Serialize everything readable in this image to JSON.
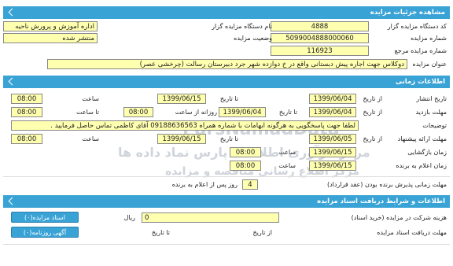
{
  "sections": {
    "details_title": "مشاهده جزئیات مزایده",
    "times_title": "اطلاعات زمانی",
    "conditions_title": "اطلاعات و شرایط دریافت اسناد مزایده"
  },
  "details": {
    "org_code_label": "کد دستگاه مزایده گزار",
    "org_code": "4888",
    "org_name_label": "نام دستگاه مزایده گزار",
    "org_name": "اداره آموزش و پرورش ناحیه",
    "number_label": "شماره مزایده",
    "number": "5099004888000060",
    "status_label": "وضعیت مزایده",
    "status": "منتشر شده",
    "ref_label": "شماره مزایده مرجع",
    "ref": "116923",
    "subject_label": "عنوان مزایده",
    "subject": "دوکلاس جهت اجاره پیش دبستانی واقع در خ دوازده شهر جرد دبیرستان رسالت (چرخشی عصر)"
  },
  "times": {
    "from_date_label": "از تاریخ",
    "to_date_label": "تا تاریخ",
    "time_label": "ساعت",
    "publish_label": "تاریخ انتشار",
    "publish_from": "1399/06/04",
    "publish_to": "1399/06/15",
    "publish_time": "08:00",
    "visit_label": "مهلت بازدید",
    "visit_from": "1399/06/04",
    "visit_to": "1399/06/04",
    "visit_daily_from_label": "روزانه از ساعت",
    "visit_daily_from": "08:00",
    "visit_daily_to_label": "تا ساعت",
    "visit_daily_to": "08:00",
    "notes_label": "توضیحات",
    "notes": "لطفا جهت پاسخگویی به هرگونه ابهامات با شماره همراه 09188636563 آقای کاظمی تماس حاصل فرمایید .",
    "offer_label": "مهلت ارائه پیشنهاد",
    "offer_from": "1399/06/05",
    "offer_to": "1399/06/15",
    "offer_time": "08:00",
    "opening_label": "زمان بازگشایی",
    "opening_date": "1399/06/15",
    "opening_time": "08:00",
    "announce_label": "زمان اعلام به برنده",
    "announce_date": "1399/06/15",
    "announce_time": "08:00",
    "acceptance_label": "مهلت زمانی پذیرش برنده بودن (عقد قرارداد)",
    "acceptance_value": "4",
    "acceptance_suffix": "روز پس از اعلام به برنده"
  },
  "conditions": {
    "fee_label": "هزینه شرکت در مزایده (خرید اسناد)",
    "fee_value": "0",
    "fee_unit": "ریال",
    "deadline_label": "مهلت دریافت اسناد مزایده",
    "deadline_from_label": "از تاریخ",
    "deadline_to_label": "تا تاریخ",
    "docs_button": "اسناد مزایده(۰)",
    "ad_button": "آگهی روزنامه(۰)"
  },
  "watermark": {
    "line1": "ParsNamadData",
    "line2": "مرکز فرآوری اطلاعات پارس نماد داده ها",
    "line3": "مرکز اطلاع رسانی مناقصه و مزایده"
  },
  "colors": {
    "header": "#3aa3d6",
    "field": "#ffffb0"
  }
}
